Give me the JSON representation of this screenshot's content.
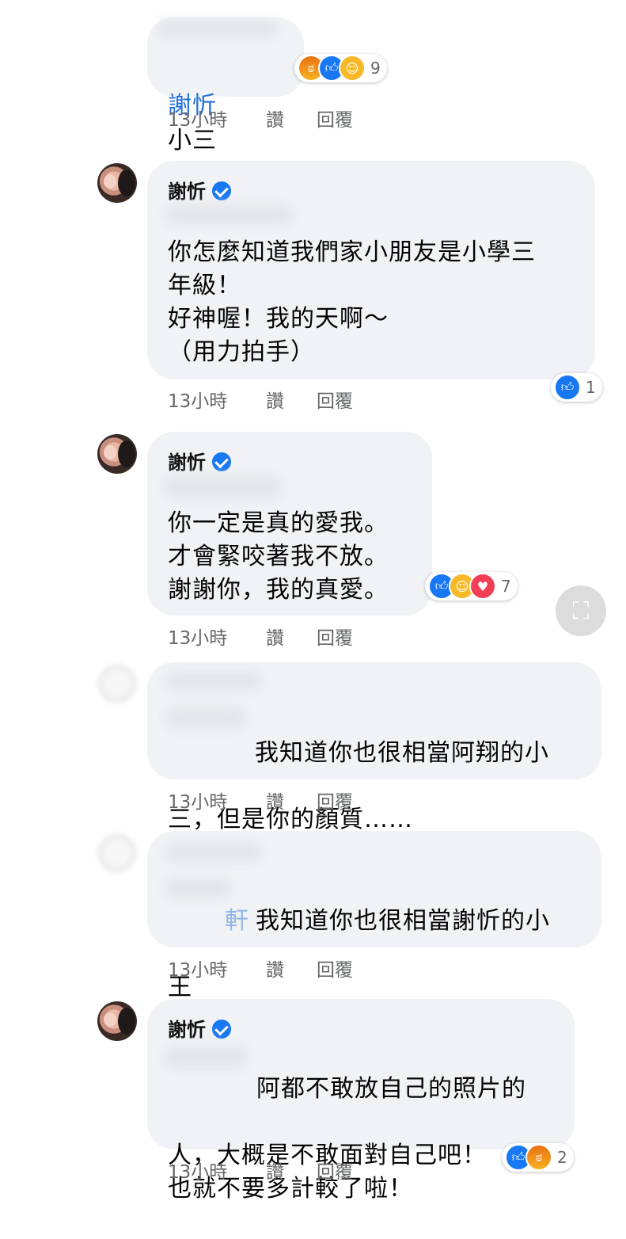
{
  "comments": [
    {
      "author": "謝忻",
      "text": "小三",
      "meta": {
        "time": "13小時",
        "like": "讚",
        "reply": "回覆"
      },
      "reactions": {
        "icons": [
          "angry-icon",
          "like-icon",
          "haha-icon"
        ],
        "count": "9"
      }
    },
    {
      "author": "謝忻",
      "verified": true,
      "text": "你怎麼知道我們家小朋友是小學三\n年級！\n好神喔！我的天啊～\n（用力拍手）",
      "meta": {
        "time": "13小時",
        "like": "讚",
        "reply": "回覆"
      },
      "reactions": {
        "icons": [
          "like-icon"
        ],
        "count": "1"
      }
    },
    {
      "author": "謝忻",
      "verified": true,
      "text": "你一定是真的愛我。\n才會緊咬著我不放。\n謝謝你，我的真愛。",
      "meta": {
        "time": "13小時",
        "like": "讚",
        "reply": "回覆"
      },
      "reactions": {
        "icons": [
          "like-icon",
          "haha-icon",
          "love-icon"
        ],
        "count": "7"
      }
    },
    {
      "text_line1": "我知道你也很相當阿翔的小",
      "text_line2": "三，但是你的顏質……",
      "meta": {
        "time": "13小時",
        "like": "讚",
        "reply": "回覆"
      }
    },
    {
      "tag_fragment": "軒",
      "text_line1": "我知道你也很相當謝忻的小",
      "text_line2": "王",
      "meta": {
        "time": "13小時",
        "like": "讚",
        "reply": "回覆"
      }
    },
    {
      "author": "謝忻",
      "verified": true,
      "text_line1": "阿都不敢放自己的照片的",
      "text_line2": "人，大概是不敢面對自己吧！\n也就不要多計較了啦！",
      "meta": {
        "time": "13小時",
        "like": "讚",
        "reply": "回覆"
      },
      "reactions": {
        "icons": [
          "like-icon",
          "angry-icon"
        ],
        "count": "2"
      }
    }
  ],
  "colors": {
    "bubble": "#f0f2f5",
    "link": "#216fdb",
    "meta": "#65676b",
    "verified": "#1877f2"
  }
}
